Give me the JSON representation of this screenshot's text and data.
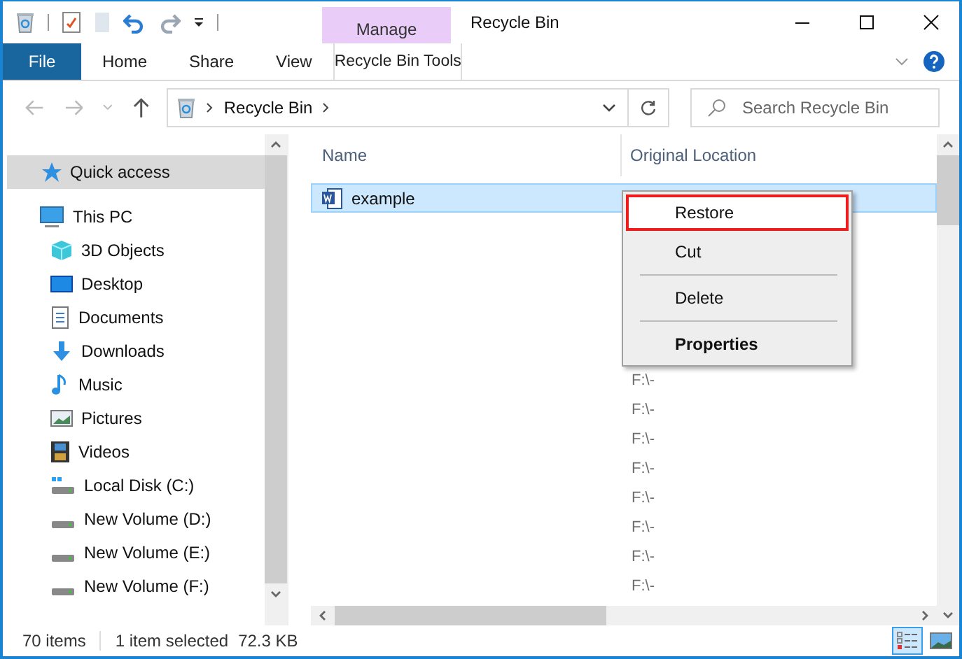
{
  "window": {
    "title": "Recycle Bin",
    "context_group": "Manage"
  },
  "ribbon": {
    "tabs": [
      {
        "label": "File",
        "kind": "file",
        "selected": false
      },
      {
        "label": "Home",
        "kind": "plain",
        "selected": false
      },
      {
        "label": "Share",
        "kind": "plain",
        "selected": false
      },
      {
        "label": "View",
        "kind": "plain",
        "selected": false
      },
      {
        "label": "Recycle Bin Tools",
        "kind": "contextual",
        "selected": false
      }
    ]
  },
  "address_bar": {
    "path": "Recycle Bin"
  },
  "search": {
    "placeholder": "Search Recycle Bin"
  },
  "sidebar": {
    "items": [
      {
        "label": "Quick access",
        "kind": "star",
        "selected": true
      },
      {
        "label": "This PC",
        "kind": "pc",
        "selected": false,
        "children": [
          {
            "label": "3D Objects",
            "kind": "cube",
            "selected": false
          },
          {
            "label": "Desktop",
            "kind": "desktop",
            "selected": false
          },
          {
            "label": "Documents",
            "kind": "document",
            "selected": false
          },
          {
            "label": "Downloads",
            "kind": "download",
            "selected": false
          },
          {
            "label": "Music",
            "kind": "music",
            "selected": false
          },
          {
            "label": "Pictures",
            "kind": "picture",
            "selected": false
          },
          {
            "label": "Videos",
            "kind": "film",
            "selected": false
          },
          {
            "label": "Local Disk (C:)",
            "kind": "systemdrive",
            "selected": false
          },
          {
            "label": "New Volume (D:)",
            "kind": "drive",
            "selected": false
          },
          {
            "label": "New Volume (E:)",
            "kind": "drive",
            "selected": false
          },
          {
            "label": "New Volume (F:)",
            "kind": "drive",
            "selected": false
          }
        ]
      }
    ]
  },
  "file_list": {
    "columns": [
      "Name",
      "Original Location"
    ],
    "rows": [
      {
        "name": "example",
        "selected": true
      },
      {
        "original_location": "F:\\-",
        "selected": false
      },
      {
        "original_location": "F:\\-",
        "selected": false
      },
      {
        "original_location": "F:\\-",
        "selected": false
      },
      {
        "original_location": "F:\\-",
        "selected": false
      },
      {
        "original_location": "F:\\-",
        "selected": false
      },
      {
        "original_location": "F:\\-",
        "selected": false
      },
      {
        "original_location": "F:\\-",
        "selected": false
      },
      {
        "original_location": "F:\\-",
        "selected": false
      }
    ]
  },
  "context_menu": {
    "items": [
      {
        "kind": "item",
        "label": "Restore",
        "highlighted": true,
        "default": false
      },
      {
        "kind": "item",
        "label": "Cut",
        "highlighted": false,
        "default": false
      },
      {
        "kind": "separator"
      },
      {
        "kind": "item",
        "label": "Delete",
        "highlighted": false,
        "default": false
      },
      {
        "kind": "separator"
      },
      {
        "kind": "item",
        "label": "Properties",
        "highlighted": false,
        "default": true
      }
    ]
  },
  "status_bar": {
    "item_count": "70 items",
    "selection": "1 item selected",
    "size": "72.3 KB",
    "views": [
      {
        "kind": "details",
        "selected": true
      },
      {
        "kind": "large-icons",
        "selected": false
      }
    ]
  }
}
